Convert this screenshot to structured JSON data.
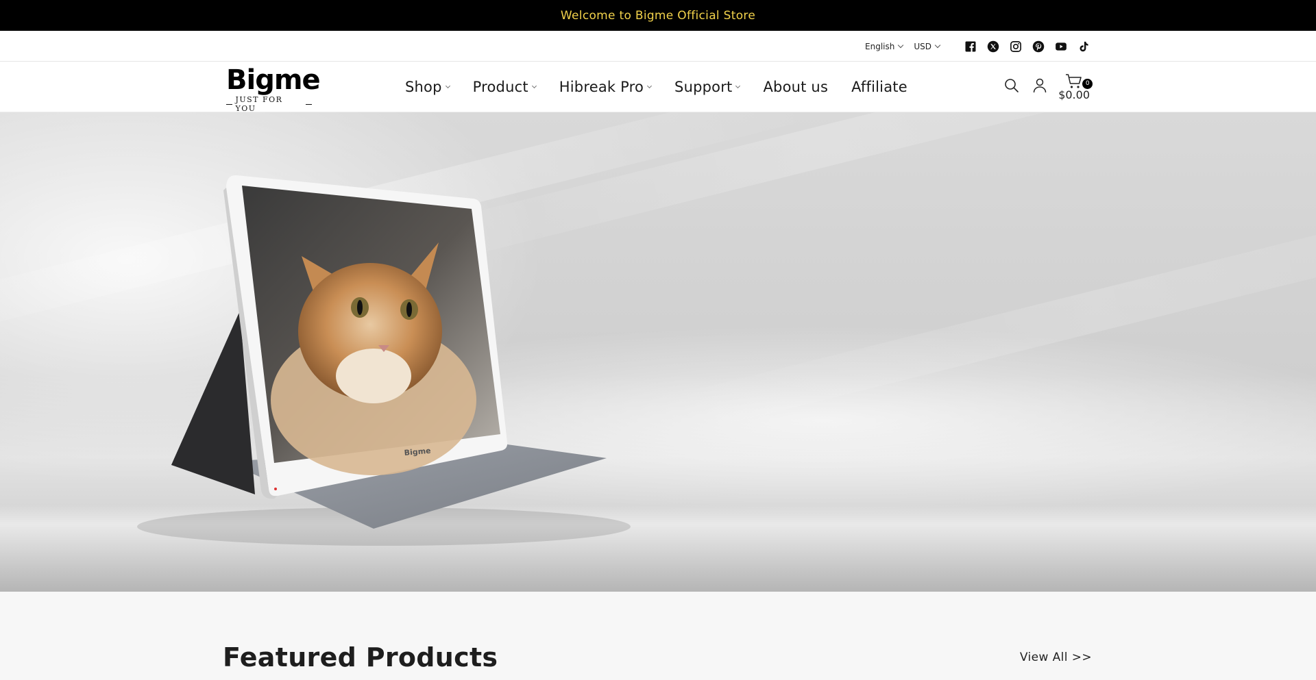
{
  "announcement": {
    "text": "Welcome to Bigme Official Store",
    "color": "#f2d24b"
  },
  "utility": {
    "language": "English",
    "currency": "USD",
    "socials": [
      "facebook-icon",
      "x-twitter-icon",
      "instagram-icon",
      "pinterest-icon",
      "youtube-icon",
      "tiktok-icon"
    ]
  },
  "header": {
    "logo": {
      "word": "Bigme",
      "tagline": "JUST FOR YOU"
    },
    "nav": [
      {
        "label": "Shop",
        "dropdown": true
      },
      {
        "label": "Product",
        "dropdown": true
      },
      {
        "label": "Hibreak Pro",
        "dropdown": true
      },
      {
        "label": "Support",
        "dropdown": true
      },
      {
        "label": "About us",
        "dropdown": false
      },
      {
        "label": "Affiliate",
        "dropdown": false
      }
    ],
    "cart": {
      "count": "0",
      "total": "$0.00"
    },
    "icons": [
      "search-icon",
      "account-icon",
      "cart-icon"
    ]
  },
  "hero": {
    "device_brand": "Bigme"
  },
  "featured": {
    "title": "Featured Products",
    "view_all": "View All >>"
  }
}
